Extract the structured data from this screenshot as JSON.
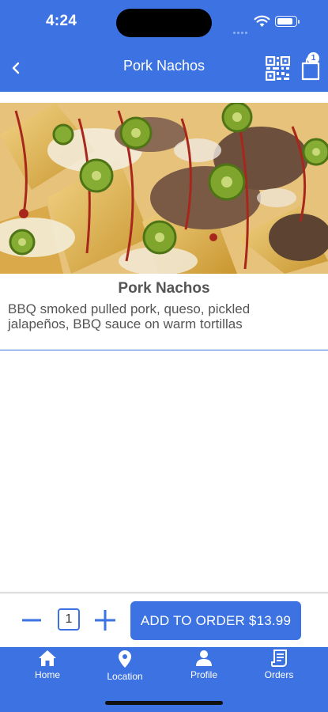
{
  "status": {
    "time": "4:24"
  },
  "header": {
    "title": "Pork Nachos",
    "cart_count": "1"
  },
  "item": {
    "name": "Pork Nachos",
    "description": "BBQ smoked pulled pork, queso, pickled jalapeños, BBQ sauce on warm tortillas"
  },
  "order": {
    "quantity": "1",
    "add_label": "ADD TO ORDER $13.99"
  },
  "tabs": [
    {
      "label": "Home",
      "icon": "home-icon"
    },
    {
      "label": "Location",
      "icon": "location-pin-icon"
    },
    {
      "label": "Profile",
      "icon": "person-icon"
    },
    {
      "label": "Orders",
      "icon": "receipt-icon"
    }
  ],
  "colors": {
    "primary": "#3c72e2",
    "text": "#555555"
  }
}
